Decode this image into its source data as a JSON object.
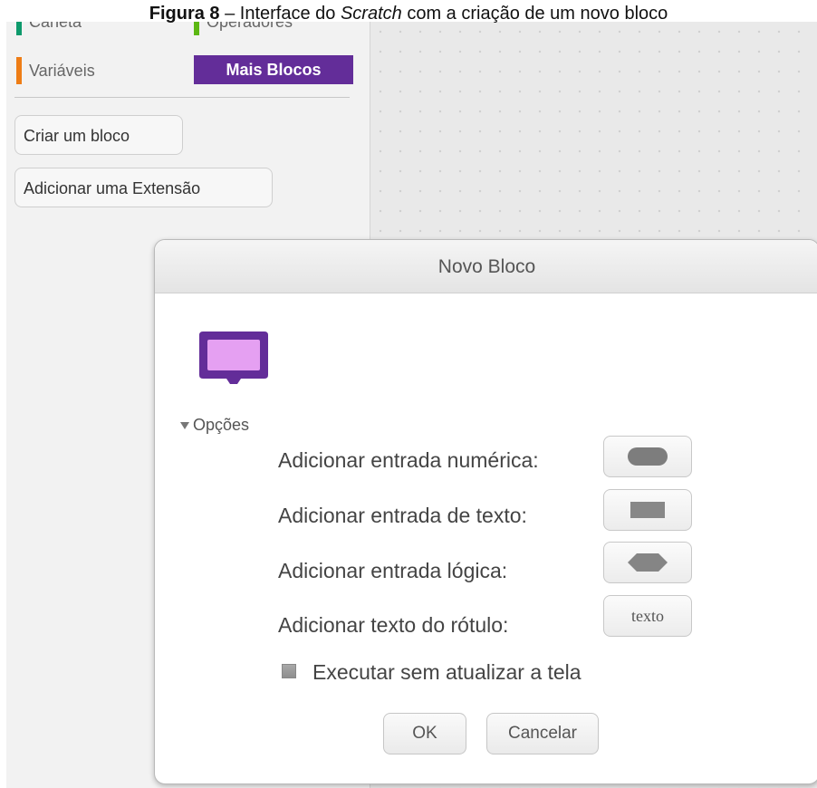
{
  "caption": {
    "prefix": "Figura 8",
    "middle": " – Interface do ",
    "italic": "Scratch",
    "suffix": " com a criação de um novo bloco"
  },
  "palette": {
    "categories": [
      {
        "label": "Caneta",
        "color": "#0e9a6c"
      },
      {
        "label": "Operadores",
        "color": "#5cb712"
      },
      {
        "label": "Variáveis",
        "color": "#ee7d16"
      },
      {
        "label": "Mais Blocos",
        "color": "#632d99",
        "selected": true
      }
    ],
    "create_block_label": "Criar um bloco",
    "add_extension_label": "Adicionar uma Extensão"
  },
  "dialog": {
    "title": "Novo Bloco",
    "block_color": "#632d99",
    "block_fill": "#e5a0f2",
    "options_label": "Opções",
    "options": [
      {
        "label": "Adicionar entrada numérica:",
        "button": "number-input-icon"
      },
      {
        "label": "Adicionar entrada de texto:",
        "button": "text-input-icon"
      },
      {
        "label": "Adicionar entrada lógica:",
        "button": "boolean-input-icon"
      },
      {
        "label": "Adicionar texto do rótulo:",
        "button_text": "texto"
      }
    ],
    "run_without_refresh_label": "Executar sem atualizar a tela",
    "ok_label": "OK",
    "cancel_label": "Cancelar"
  }
}
